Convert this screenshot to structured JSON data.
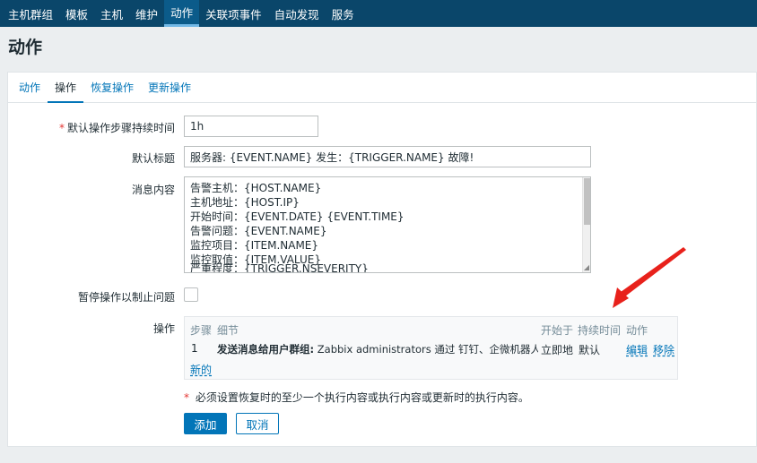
{
  "topnav": {
    "items": [
      {
        "label": "主机群组"
      },
      {
        "label": "模板"
      },
      {
        "label": "主机"
      },
      {
        "label": "维护"
      },
      {
        "label": "动作",
        "active": true
      },
      {
        "label": "关联项事件"
      },
      {
        "label": "自动发现"
      },
      {
        "label": "服务"
      }
    ]
  },
  "page": {
    "title": "动作"
  },
  "tabs": [
    {
      "label": "动作"
    },
    {
      "label": "操作",
      "active": true
    },
    {
      "label": "恢复操作"
    },
    {
      "label": "更新操作"
    }
  ],
  "form": {
    "step_duration": {
      "required_mark": "*",
      "label": "默认操作步骤持续时间",
      "value": "1h"
    },
    "subject": {
      "label": "默认标题",
      "value": "服务器: {EVENT.NAME} 发生：{TRIGGER.NAME} 故障!"
    },
    "message": {
      "label": "消息内容",
      "lines": [
        "告警主机：{HOST.NAME}",
        "主机地址：{HOST.IP}",
        "开始时间：{EVENT.DATE} {EVENT.TIME}",
        "告警问题：{EVENT.NAME}",
        "监控项目：{ITEM.NAME}",
        "监控取值：{ITEM.VALUE}",
        "严重程度：{TRIGGER.NSEVERITY}"
      ]
    },
    "pause": {
      "label": "暂停操作以制止问题",
      "checked": false
    },
    "operations": {
      "label": "操作",
      "headers": {
        "step": "步骤",
        "details": "细节",
        "start_in": "开始于",
        "duration": "持续时间",
        "action": "动作"
      },
      "rows": [
        {
          "step": "1",
          "details_bold": "发送消息给用户群组:",
          "details_rest": " Zabbix administrators 通过 钉钉、企微机器人",
          "start_in": "立即地",
          "duration": "默认",
          "edit": "编辑",
          "remove": "移除"
        }
      ],
      "new_link": "新的"
    },
    "required_note_mark": "*",
    "required_note": " 必须设置恢复时的至少一个执行内容或执行内容或更新时的执行内容。",
    "add_button": "添加",
    "cancel_button": "取消"
  },
  "colors": {
    "header_bg": "#0a466a",
    "link": "#0275b8",
    "annotation_arrow": "#e8211b"
  }
}
